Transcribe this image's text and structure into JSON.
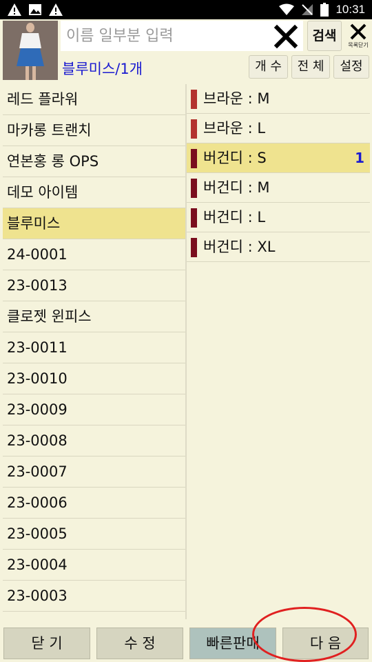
{
  "status": {
    "time": "10:31",
    "left_icons": [
      "warning-icon",
      "image-icon",
      "warning-icon"
    ],
    "right_icons": [
      "wifi-icon",
      "signal-off-icon",
      "battery-icon"
    ]
  },
  "header": {
    "search_placeholder": "이름 일부분 입력",
    "search_label": "검색",
    "close_list_label": "목록닫기",
    "product_label": "블루미스/1개",
    "btn_count": "개 수",
    "btn_all": "전 체",
    "btn_settings": "설정"
  },
  "left_items": [
    {
      "label": "레드 플라워"
    },
    {
      "label": "마카롱 트랜치"
    },
    {
      "label": "연본홍  롱 OPS"
    },
    {
      "label": "데모 아이템"
    },
    {
      "label": "블루미스"
    },
    {
      "label": "24-0001"
    },
    {
      "label": "23-0013"
    },
    {
      "label": "클로젯 윈피스"
    },
    {
      "label": "23-0011"
    },
    {
      "label": "23-0010"
    },
    {
      "label": "23-0009"
    },
    {
      "label": "23-0008"
    },
    {
      "label": "23-0007"
    },
    {
      "label": "23-0006"
    },
    {
      "label": "23-0005"
    },
    {
      "label": "23-0004"
    },
    {
      "label": "23-0003"
    }
  ],
  "selected_left_index": 4,
  "right_items": [
    {
      "label": "브라운 : M",
      "color": "#b3322e",
      "count": ""
    },
    {
      "label": "브라운 : L",
      "color": "#b3322e",
      "count": ""
    },
    {
      "label": "버건디 : S",
      "color": "#7a0e1e",
      "count": "1"
    },
    {
      "label": "버건디 : M",
      "color": "#7a0e1e",
      "count": ""
    },
    {
      "label": "버건디 : L",
      "color": "#7a0e1e",
      "count": ""
    },
    {
      "label": "버건디 : XL",
      "color": "#7a0e1e",
      "count": ""
    }
  ],
  "selected_right_index": 2,
  "bottom": {
    "close": "닫 기",
    "edit": "수 정",
    "quick_sale": "빠른판매",
    "next": "다 음"
  },
  "colors": {
    "selected": "#efe38f",
    "accent_text": "#1a1ad0",
    "annotation": "#e02020"
  }
}
